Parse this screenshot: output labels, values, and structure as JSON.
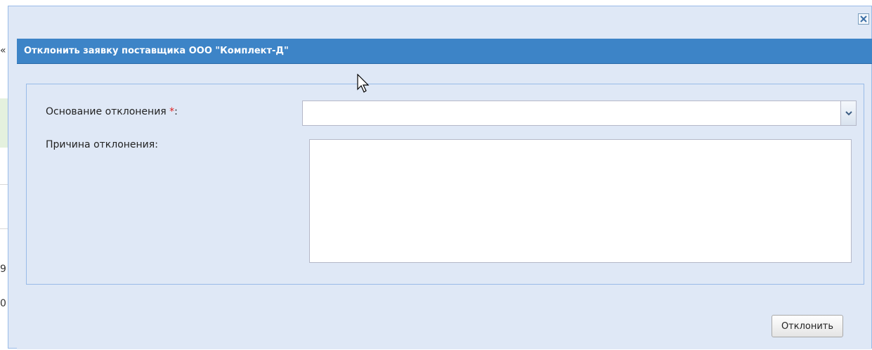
{
  "dialog": {
    "title": "Отклонить заявку поставщика ООО \"Комплект-Д\"",
    "close_icon": "close-icon"
  },
  "form": {
    "reason_basis_label": "Основание отклонения",
    "required_marker": "*",
    "label_suffix": ":",
    "reason_basis_value": "",
    "reason_text_label": "Причина отклонения:",
    "reason_text_value": ""
  },
  "footer": {
    "reject_button_label": "Отклонить"
  },
  "background": {
    "glyphs": [
      "«",
      "9",
      "0"
    ]
  },
  "colors": {
    "header": "#3d84c7",
    "window_bg": "#dfe8f6",
    "required": "#e02020"
  }
}
